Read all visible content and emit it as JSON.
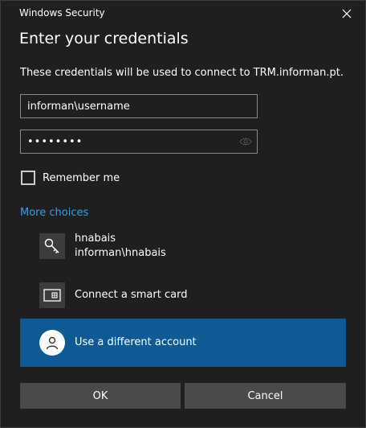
{
  "window": {
    "title": "Windows Security",
    "close_label": "close"
  },
  "heading": "Enter your credentials",
  "description": "These credentials will be used to connect to TRM.informan.pt.",
  "fields": {
    "username": {
      "value": "informan\\username"
    },
    "password": {
      "value": "••••••••"
    }
  },
  "remember": {
    "label": "Remember me",
    "checked": false
  },
  "more_choices": "More choices",
  "accounts": [
    {
      "name": "hnabais",
      "domain": "informan\\hnabais",
      "icon": "key-icon"
    },
    {
      "name": "Connect a smart card",
      "icon": "smart-card-icon"
    },
    {
      "name": "Use a different account",
      "icon": "user-icon",
      "selected": true
    }
  ],
  "buttons": {
    "ok": "OK",
    "cancel": "Cancel"
  },
  "colors": {
    "background": "#1f1f1f",
    "accent_link": "#3a9fe6",
    "selected": "#0e5a94",
    "button": "#4a4a4a"
  }
}
